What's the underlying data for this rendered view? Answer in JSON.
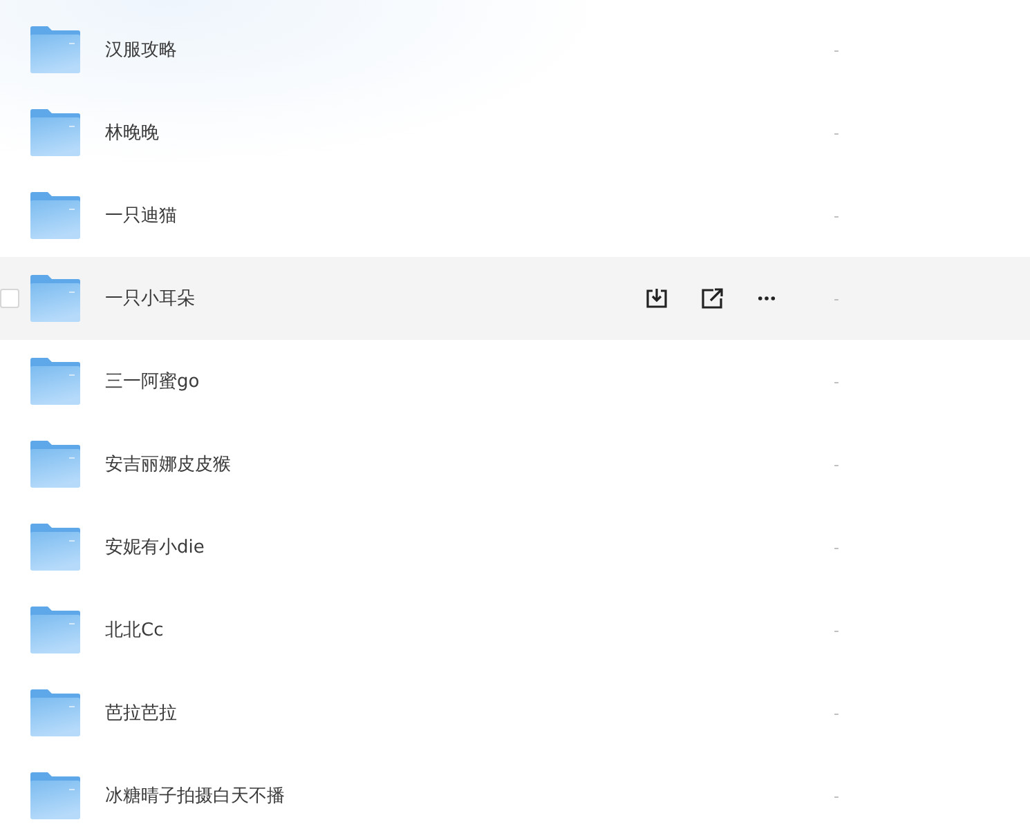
{
  "rows": [
    {
      "name": "汉服攻略",
      "size": "-",
      "hovered": false,
      "checked": false
    },
    {
      "name": "林晚晚",
      "size": "-",
      "hovered": false,
      "checked": false
    },
    {
      "name": "一只迪猫",
      "size": "-",
      "hovered": false,
      "checked": false
    },
    {
      "name": "一只小耳朵",
      "size": "-",
      "hovered": true,
      "checked": false
    },
    {
      "name": "三一阿蜜go",
      "size": "-",
      "hovered": false,
      "checked": false
    },
    {
      "name": "安吉丽娜皮皮猴",
      "size": "-",
      "hovered": false,
      "checked": false
    },
    {
      "name": "安妮有小die",
      "size": "-",
      "hovered": false,
      "checked": false
    },
    {
      "name": "北北Cc",
      "size": "-",
      "hovered": false,
      "checked": false
    },
    {
      "name": "芭拉芭拉",
      "size": "-",
      "hovered": false,
      "checked": false
    },
    {
      "name": "冰糖晴子拍摄白天不播",
      "size": "-",
      "hovered": false,
      "checked": false
    }
  ]
}
